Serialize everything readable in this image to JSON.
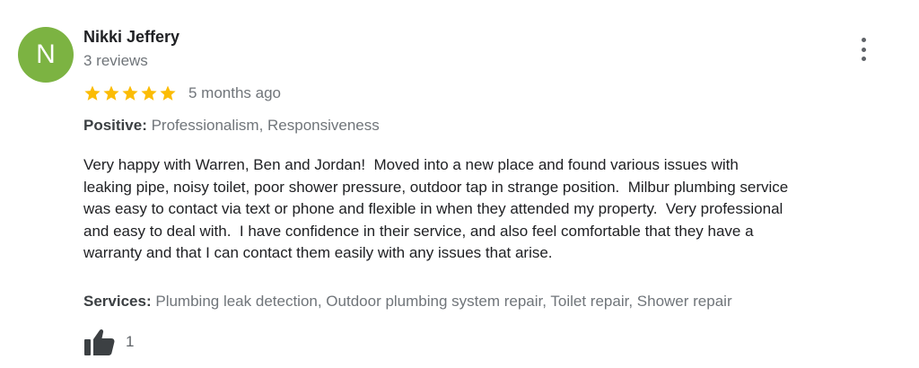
{
  "reviewer": {
    "initial": "N",
    "avatar_color": "#7cb342",
    "name": "Nikki Jeffery",
    "review_count": "3 reviews"
  },
  "rating": {
    "stars": 5,
    "max_stars": 5,
    "star_color": "#fbbc04",
    "time_ago": "5 months ago"
  },
  "positive": {
    "label": "Positive:",
    "value": "Professionalism, Responsiveness"
  },
  "review_text": "Very happy with Warren, Ben and Jordan!  Moved into a new place and found various issues with\nleaking pipe, noisy toilet, poor shower pressure, outdoor tap in strange position.  Milbur plumbing service\nwas easy to contact via text or phone and flexible in when they attended my property.  Very professional\nand easy to deal with.  I have confidence in their service, and also feel comfortable that they have a\nwarranty and that I can contact them easily with any issues that arise.",
  "services": {
    "label": "Services:",
    "value": "Plumbing leak detection, Outdoor plumbing system repair, Toilet repair, Shower repair"
  },
  "likes": {
    "icon": "thumbs-up-icon",
    "count": "1"
  },
  "menu": {
    "icon": "more-vert-icon"
  }
}
